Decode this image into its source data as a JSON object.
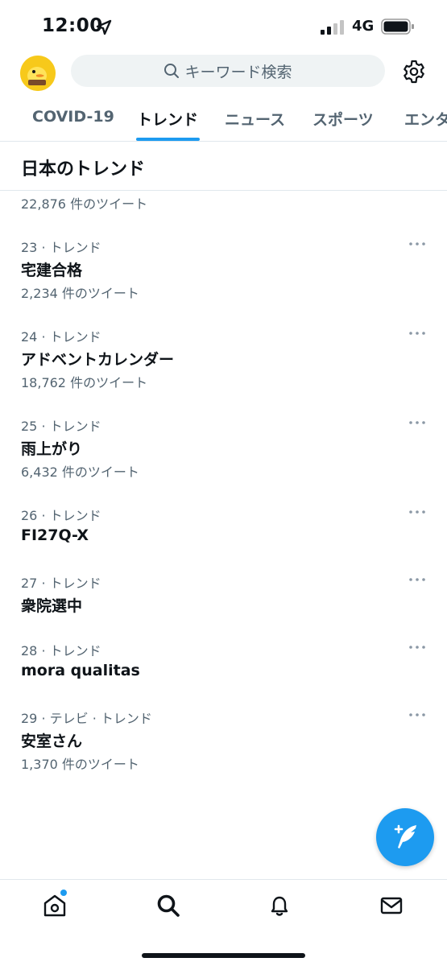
{
  "status_bar": {
    "time": "12:00",
    "network": "4G"
  },
  "header": {
    "search_placeholder": "キーワード検索"
  },
  "tabs": [
    {
      "label": "COVID-19"
    },
    {
      "label": "トレンド",
      "active": true
    },
    {
      "label": "ニュース"
    },
    {
      "label": "スポーツ"
    },
    {
      "label": "エンタ"
    }
  ],
  "section_title": "日本のトレンド",
  "partial_trend": {
    "count": "22,876 件のツイート"
  },
  "trends": [
    {
      "meta": "23 · トレンド",
      "name": "宅建合格",
      "count": "2,234 件のツイート"
    },
    {
      "meta": "24 · トレンド",
      "name": "アドベントカレンダー",
      "count": "18,762 件のツイート"
    },
    {
      "meta": "25 · トレンド",
      "name": "雨上がり",
      "count": "6,432 件のツイート"
    },
    {
      "meta": "26 · トレンド",
      "name": "FI27Q-X",
      "count": ""
    },
    {
      "meta": "27 · トレンド",
      "name": "衆院選中",
      "count": ""
    },
    {
      "meta": "28 · トレンド",
      "name": "mora qualitas",
      "count": ""
    },
    {
      "meta": "29 · テレビ · トレンド",
      "name": "安室さん",
      "count": "1,370 件のツイート"
    }
  ],
  "icons": {
    "search": "search-icon",
    "settings": "gear-icon",
    "more": "more-horizontal-icon",
    "compose": "compose-tweet-icon",
    "nav": [
      "home-icon",
      "search-icon",
      "bell-icon",
      "mail-icon"
    ]
  },
  "colors": {
    "accent": "#1d9bf0",
    "text": "#0f1419",
    "secondary": "#536471"
  }
}
